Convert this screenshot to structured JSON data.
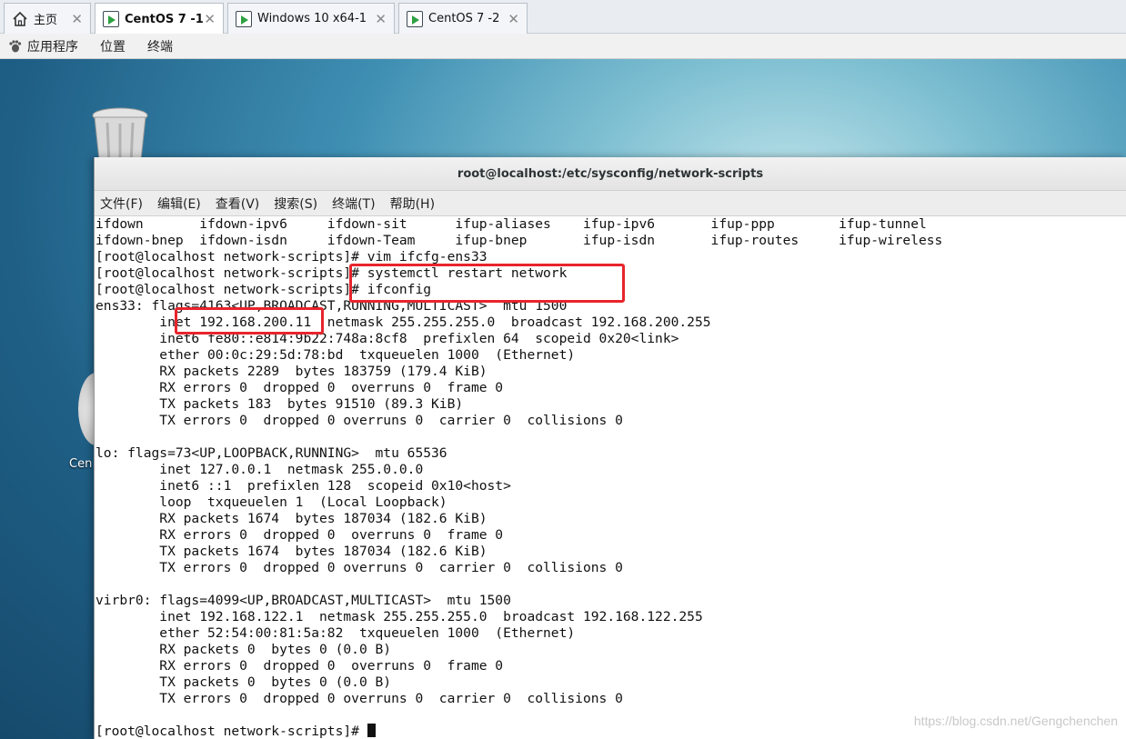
{
  "tabs": [
    {
      "label": "主页",
      "icon": "home-icon",
      "active": false
    },
    {
      "label": "CentOS 7 -1",
      "icon": "vm-icon",
      "active": true
    },
    {
      "label": "Windows 10 x64-1",
      "icon": "vm-icon",
      "active": false
    },
    {
      "label": "CentOS 7 -2",
      "icon": "vm-icon",
      "active": false
    }
  ],
  "tab_close_glyph": "✕",
  "gnome_bar": {
    "applications": "应用程序",
    "places": "位置",
    "terminal": "终端"
  },
  "desktop": {
    "icon_label_partial": "Cen"
  },
  "terminal": {
    "title": "root@localhost:/etc/sysconfig/network-scripts",
    "menu": [
      "文件(F)",
      "编辑(E)",
      "查看(V)",
      "搜索(S)",
      "终端(T)",
      "帮助(H)"
    ],
    "lines": [
      "ifdown       ifdown-ipv6     ifdown-sit      ifup-aliases    ifup-ipv6       ifup-ppp        ifup-tunnel",
      "ifdown-bnep  ifdown-isdn     ifdown-Team     ifup-bnep       ifup-isdn       ifup-routes     ifup-wireless",
      "[root@localhost network-scripts]# vim ifcfg-ens33",
      "[root@localhost network-scripts]# systemctl restart network",
      "[root@localhost network-scripts]# ifconfig",
      "ens33: flags=4163<UP,BROADCAST,RUNNING,MULTICAST>  mtu 1500",
      "        inet 192.168.200.11  netmask 255.255.255.0  broadcast 192.168.200.255",
      "        inet6 fe80::e814:9b22:748a:8cf8  prefixlen 64  scopeid 0x20<link>",
      "        ether 00:0c:29:5d:78:bd  txqueuelen 1000  (Ethernet)",
      "        RX packets 2289  bytes 183759 (179.4 KiB)",
      "        RX errors 0  dropped 0  overruns 0  frame 0",
      "        TX packets 183  bytes 91510 (89.3 KiB)",
      "        TX errors 0  dropped 0 overruns 0  carrier 0  collisions 0",
      "",
      "lo: flags=73<UP,LOOPBACK,RUNNING>  mtu 65536",
      "        inet 127.0.0.1  netmask 255.0.0.0",
      "        inet6 ::1  prefixlen 128  scopeid 0x10<host>",
      "        loop  txqueuelen 1  (Local Loopback)",
      "        RX packets 1674  bytes 187034 (182.6 KiB)",
      "        RX errors 0  dropped 0  overruns 0  frame 0",
      "        TX packets 1674  bytes 187034 (182.6 KiB)",
      "        TX errors 0  dropped 0 overruns 0  carrier 0  collisions 0",
      "",
      "virbr0: flags=4099<UP,BROADCAST,MULTICAST>  mtu 1500",
      "        inet 192.168.122.1  netmask 255.255.255.0  broadcast 192.168.122.255",
      "        ether 52:54:00:81:5a:82  txqueuelen 1000  (Ethernet)",
      "        RX packets 0  bytes 0 (0.0 B)",
      "        RX errors 0  dropped 0  overruns 0  frame 0",
      "        TX packets 0  bytes 0 (0.0 B)",
      "        TX errors 0  dropped 0 overruns 0  carrier 0  collisions 0",
      ""
    ],
    "prompt": "[root@localhost network-scripts]# "
  },
  "watermark": "https://blog.csdn.net/Gengchenchen",
  "colors": {
    "highlight": "#e8242c",
    "vm_play": "#2ea043"
  }
}
